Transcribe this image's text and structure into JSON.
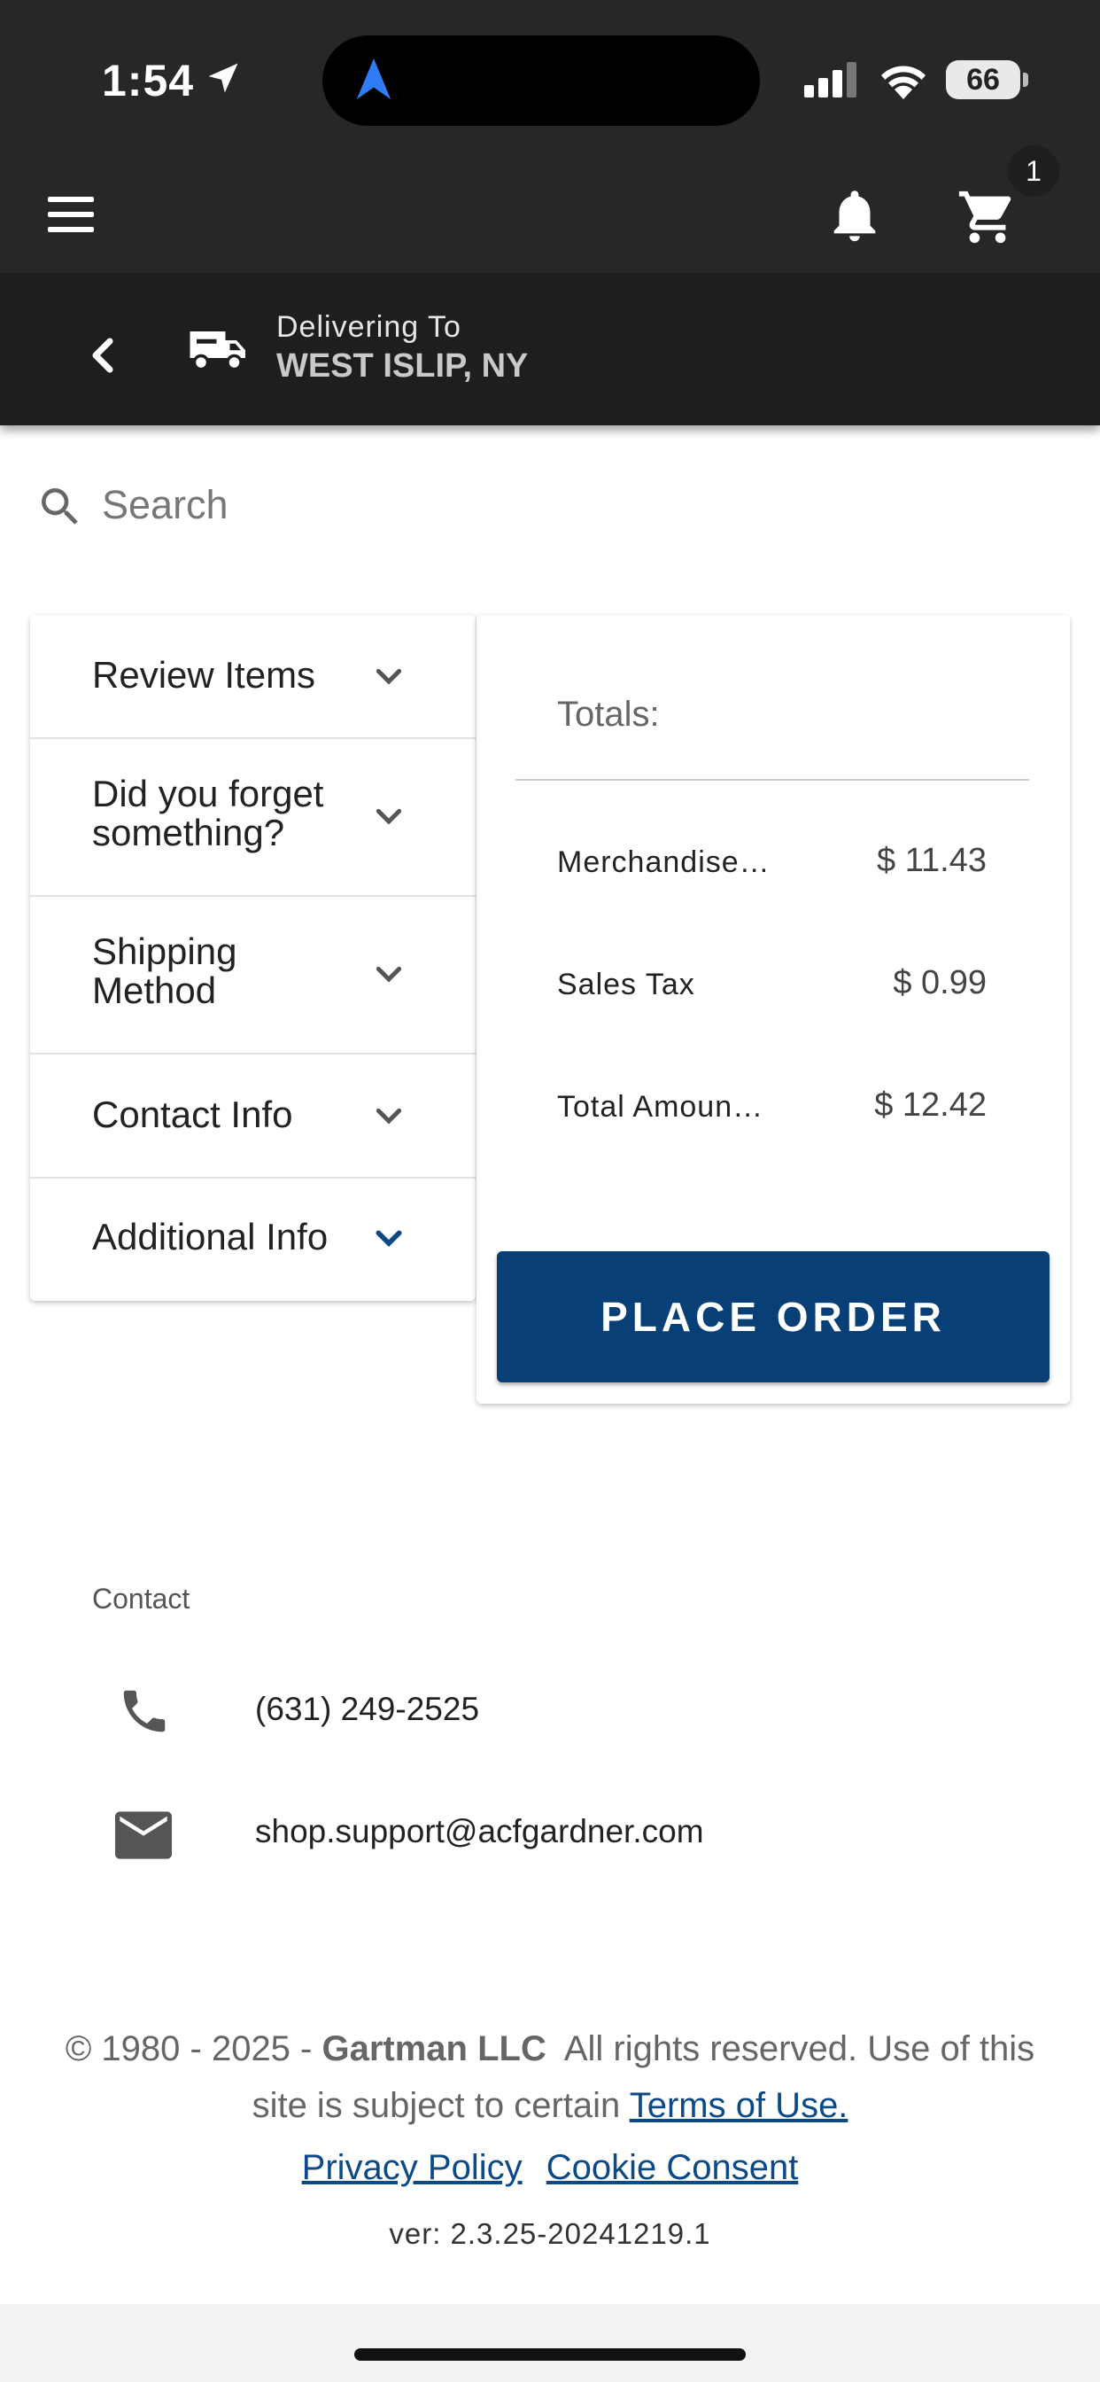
{
  "status_bar": {
    "time": "1:54",
    "battery": "66"
  },
  "header": {
    "cart_count": "1"
  },
  "delivery": {
    "label": "Delivering To",
    "location": "WEST ISLIP, NY"
  },
  "search": {
    "placeholder": "Search"
  },
  "accordion": {
    "items": [
      {
        "label": "Review Items"
      },
      {
        "label": "Did you forget something?"
      },
      {
        "label": "Shipping Method"
      },
      {
        "label": "Contact Info"
      },
      {
        "label": "Additional Info"
      }
    ]
  },
  "totals": {
    "heading": "Totals:",
    "rows": [
      {
        "label": "Merchandise…",
        "value": "$ 11.43"
      },
      {
        "label": "Sales Tax",
        "value": "$ 0.99"
      },
      {
        "label": "Total Amoun…",
        "value": "$ 12.42"
      }
    ],
    "button_label": "PLACE ORDER"
  },
  "contact": {
    "title": "Contact",
    "phone": "(631) 249-2525",
    "email": "shop.support@acfgardner.com"
  },
  "footer": {
    "copyright_prefix": "© 1980 - 2025 - ",
    "company": "Gartman LLC",
    "rights_text": "  All rights reserved. Use of this",
    "line2_text": "site is subject to certain ",
    "terms_link": "Terms of Use.",
    "privacy_link": "Privacy Policy",
    "cookie_link": "Cookie Consent",
    "version": "ver: 2.3.25-20241219.1"
  },
  "colors": {
    "accent": "#083f76",
    "link": "#0b4a86",
    "header_bg": "#272727",
    "accordion_accent_chevron": "#0b4a86"
  }
}
